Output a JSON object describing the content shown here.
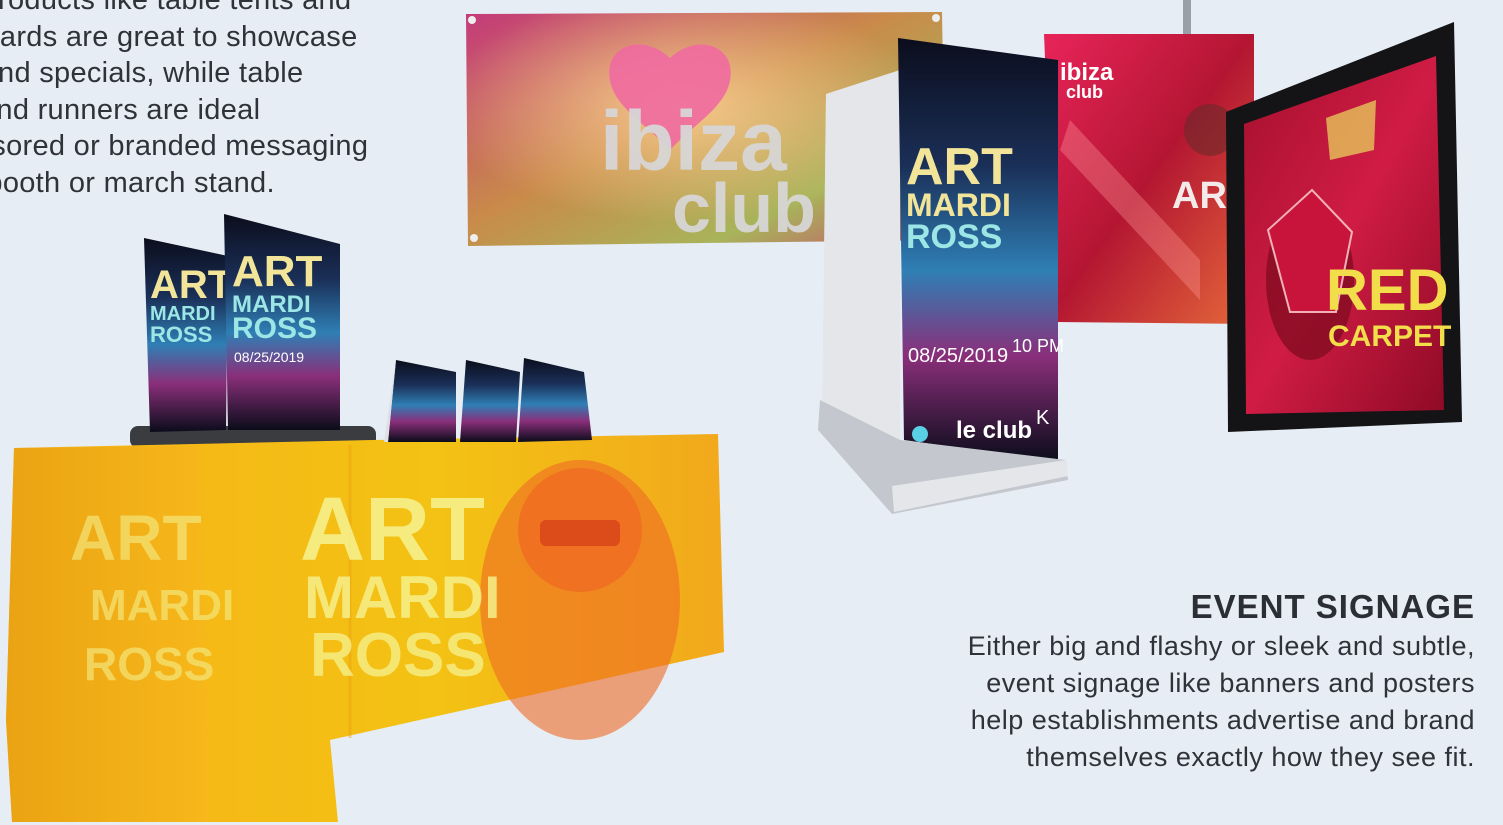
{
  "intro": {
    "lines": [
      "ay products like table tents and",
      "ter cards are great to showcase",
      "us and specials, while table",
      "vs and runners are ideal",
      "ponsored or branded messaging",
      "DJ booth or march stand."
    ]
  },
  "section": {
    "heading": "EVENT SIGNAGE",
    "lines": [
      "Either big and flashy or sleek and subtle,",
      "event signage like banners and posters",
      "help establishments advertise and brand",
      "themselves exactly how they see fit."
    ]
  },
  "banner": {
    "line1": "ibiza",
    "line2": "club"
  },
  "poster": {
    "title1": "ART",
    "title2": "MARDI",
    "title3": "ROSS",
    "date": "08/25/2019",
    "time": "10 PM",
    "club": "le club",
    "k": "K"
  },
  "hanging": {
    "logo1": "ibiza",
    "logo2": "club",
    "fragment": "ARA"
  },
  "frame": {
    "line1": "RED",
    "line2": "CARPET"
  },
  "colors": {
    "bg": "#e6edf4",
    "text": "#2f3239",
    "tablecloth": "#f5b418",
    "banner": "#b33d6d",
    "frame": "#b8123a"
  }
}
